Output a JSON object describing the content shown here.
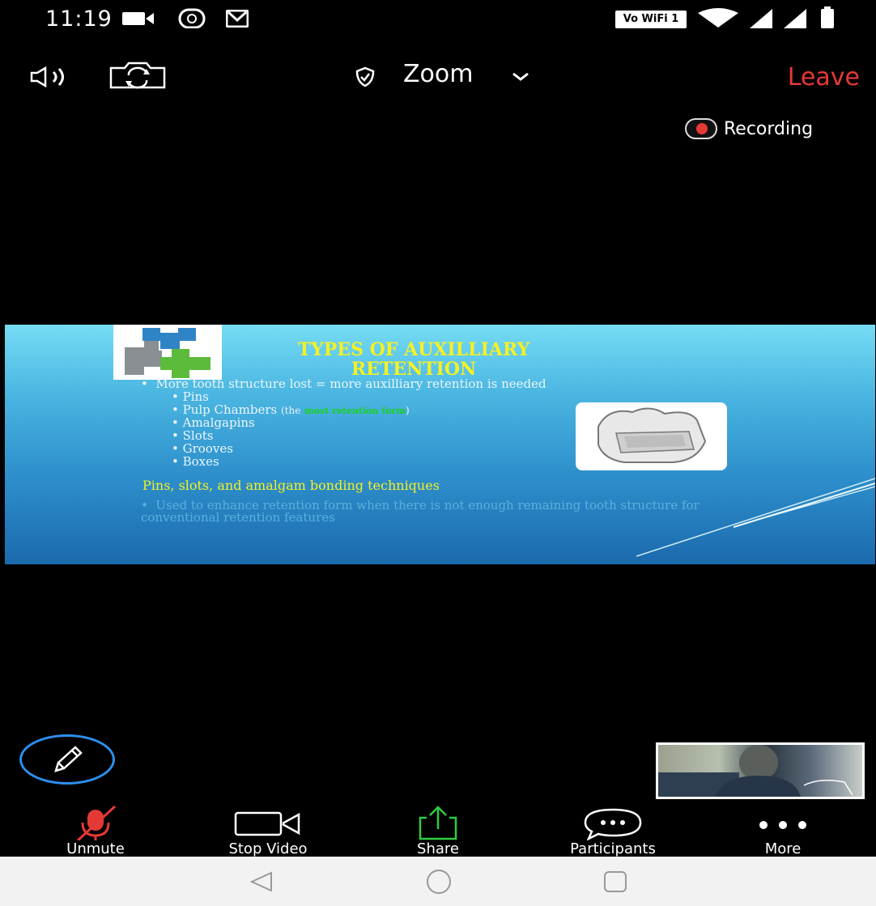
{
  "status_bar": {
    "time": "11:19",
    "wifi_badge": "Vo WiFi 1",
    "icons": [
      "video-icon",
      "radio-icon",
      "gmail-icon",
      "wifi-icon",
      "signal-icon",
      "signal-icon",
      "battery-icon"
    ]
  },
  "top_bar": {
    "speaker_icon": "speaker-icon",
    "switch_camera_icon": "switch-camera-icon",
    "shield_icon": "shield-icon",
    "meeting_title": "Zoom",
    "leave_label": "Leave",
    "leave_color": "#e53935"
  },
  "recording": {
    "label": "Recording"
  },
  "slide": {
    "title_line1": "TYPES OF AUXILLIARY",
    "title_line2": "RETENTION",
    "bullet_main": "More tooth structure lost = more auxilliary retention is needed",
    "sub_bullets": [
      "Pins",
      "Amalgapins",
      "Slots",
      "Grooves",
      "Boxes"
    ],
    "pulp_prefix": "Pulp Chambers",
    "pulp_paren_open": "(the",
    "pulp_highlight": "most retention form",
    "pulp_paren_close": ")",
    "subheading": "Pins, slots, and amalgam bonding techniques",
    "bullet2": "Used to enhance retention form when there is not enough remaining tooth structure for conventional retention features",
    "title_color": "#f4f124"
  },
  "toolbar": {
    "items": [
      {
        "label": "Unmute",
        "icon": "muted-mic-icon"
      },
      {
        "label": "Stop Video",
        "icon": "video-camera-icon"
      },
      {
        "label": "Share",
        "icon": "share-icon"
      },
      {
        "label": "Participants",
        "icon": "chat-bubble-icon"
      },
      {
        "label": "More",
        "icon": "more-dots-icon"
      }
    ],
    "mute_color": "#e53935",
    "share_color": "#2ecc40"
  },
  "nav_bar": {
    "icons": [
      "back-icon",
      "home-icon",
      "recents-icon"
    ]
  }
}
